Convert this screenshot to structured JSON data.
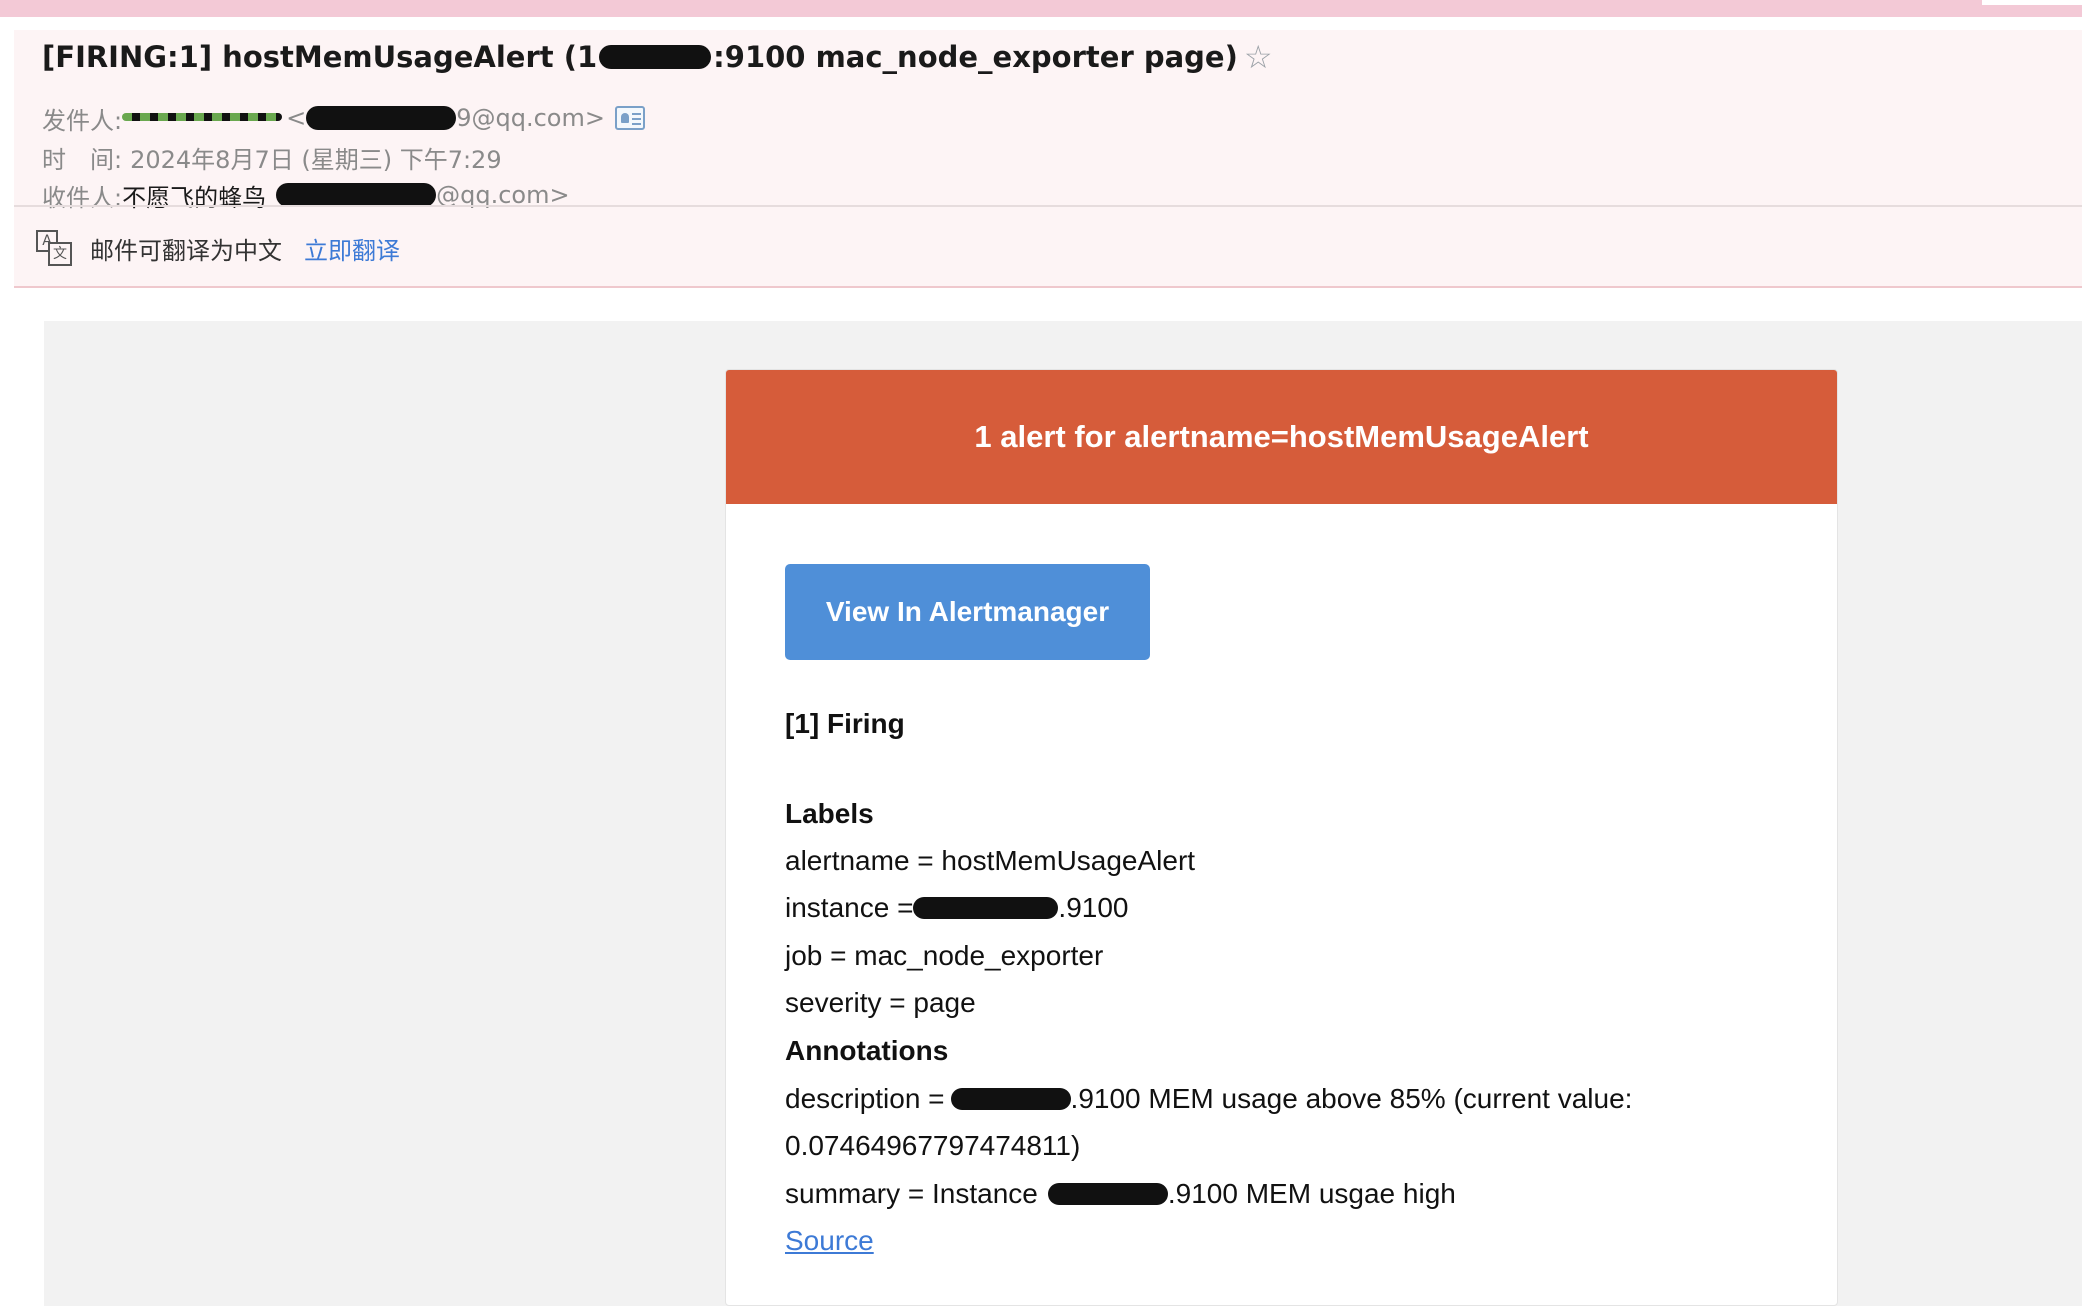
{
  "email": {
    "subject_prefix": "[FIRING:1] hostMemUsageAlert (1",
    "subject_suffix": ":9100 mac_node_exporter page)",
    "star_icon": "☆",
    "from_label": "发件人:",
    "from_sender_tail": "<",
    "from_address": "9@qq.com>",
    "time_label": "时　间:",
    "time_value": "2024年8月7日 (星期三) 下午7:29",
    "to_label": "收件人:",
    "to_name": "不愿飞的蜂鸟",
    "to_address": "@qq.com>",
    "translate_text": "邮件可翻译为中文",
    "translate_link": "立即翻译"
  },
  "alert": {
    "header_title": "1 alert for alertname=hostMemUsageAlert",
    "view_button_label": "View In Alertmanager",
    "firing_heading": "[1] Firing",
    "labels_heading": "Labels",
    "label_alertname": "alertname = hostMemUsageAlert",
    "label_instance_prefix": "instance =",
    "label_instance_suffix": ".9100",
    "label_job": "job = mac_node_exporter",
    "label_severity": "severity = page",
    "annotations_heading": "Annotations",
    "annotation_description_prefix": "description =",
    "annotation_description_suffix": ".9100 MEM usage above 85% (current value:",
    "annotation_description_value": "0.07464967797474811)",
    "annotation_summary_prefix": "summary = Instance",
    "annotation_summary_suffix": ".9100 MEM usgae high",
    "source_link": "Source"
  },
  "colors": {
    "header_bg": "#d65c3a",
    "button_bg": "#4f8fd8",
    "link": "#3d7ad6",
    "mail_header_bg": "#fdf4f5"
  }
}
